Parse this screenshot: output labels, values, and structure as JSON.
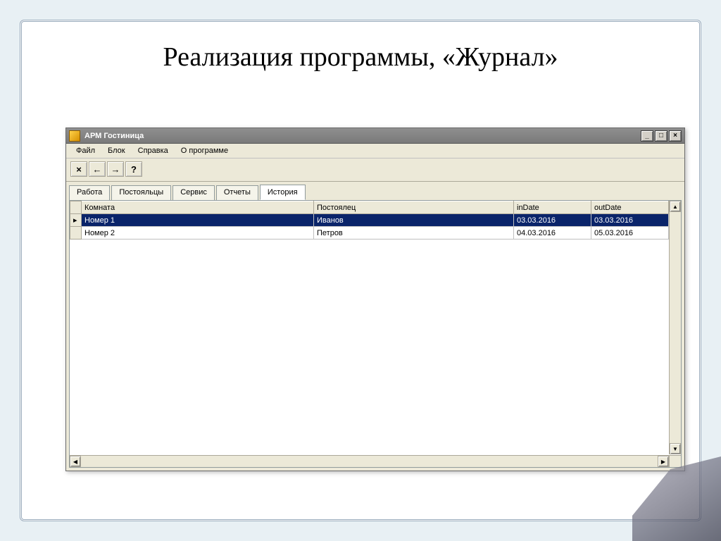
{
  "slide": {
    "title": "Реализация программы, «Журнал»"
  },
  "window": {
    "title": "АРМ Гостиница"
  },
  "menu": {
    "file": "Файл",
    "block": "Блок",
    "help": "Справка",
    "about": "О программе"
  },
  "toolbar": {
    "close": "×",
    "back": "←",
    "forward": "→",
    "question": "?"
  },
  "tabs": {
    "work": "Работа",
    "guests": "Постояльцы",
    "service": "Сервис",
    "reports": "Отчеты",
    "history": "История"
  },
  "grid": {
    "headers": {
      "room": "Комната",
      "guest": "Постоялец",
      "inDate": "inDate",
      "outDate": "outDate"
    },
    "rows": [
      {
        "marker": "▸",
        "room": "Номер 1",
        "guest": "Иванов",
        "inDate": "03.03.2016",
        "outDate": "03.03.2016",
        "selected": true
      },
      {
        "marker": "",
        "room": "Номер 2",
        "guest": "Петров",
        "inDate": "04.03.2016",
        "outDate": "05.03.2016",
        "selected": false
      }
    ]
  },
  "scroll": {
    "up": "▲",
    "down": "▼",
    "left": "◀",
    "right": "▶"
  },
  "wincontrols": {
    "min": "_",
    "max": "□",
    "close": "×"
  }
}
